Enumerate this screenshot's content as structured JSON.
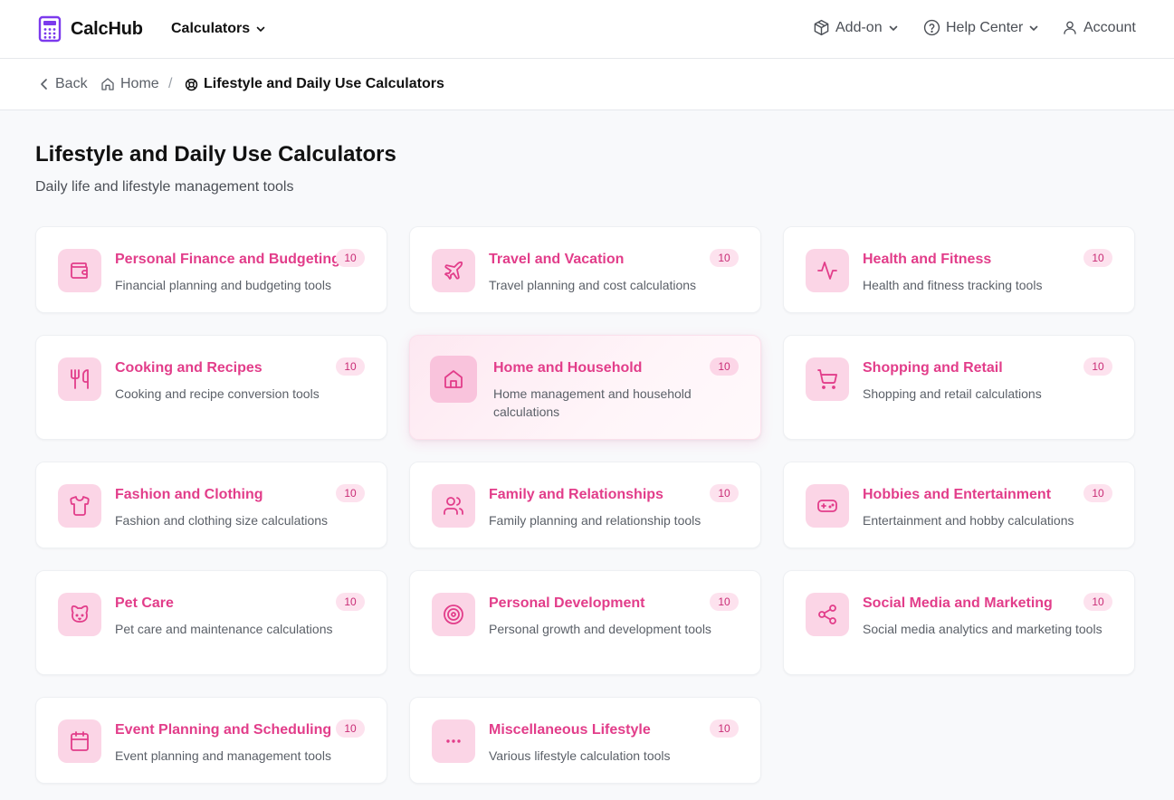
{
  "app": {
    "name": "CalcHub"
  },
  "nav": {
    "calculators_label": "Calculators",
    "addon_label": "Add-on",
    "help_label": "Help Center",
    "account_label": "Account"
  },
  "breadcrumb": {
    "back_label": "Back",
    "home_label": "Home",
    "separator": "/",
    "current_label": "Lifestyle and Daily Use Calculators"
  },
  "page": {
    "title": "Lifestyle and Daily Use Calculators",
    "subtitle": "Daily life and lifestyle management tools"
  },
  "colors": {
    "accent": "#e23d8a",
    "icon_bg": "#fbd5e6",
    "badge_bg": "#fde2ee",
    "brand": "#7c3aed"
  },
  "categories": [
    {
      "title": "Personal Finance and Budgeting",
      "desc": "Financial planning and budgeting tools",
      "count": "10",
      "icon": "wallet-icon"
    },
    {
      "title": "Travel and Vacation",
      "desc": "Travel planning and cost calculations",
      "count": "10",
      "icon": "plane-icon"
    },
    {
      "title": "Health and Fitness",
      "desc": "Health and fitness tracking tools",
      "count": "10",
      "icon": "activity-icon"
    },
    {
      "title": "Cooking and Recipes",
      "desc": "Cooking and recipe conversion tools",
      "count": "10",
      "icon": "utensils-icon"
    },
    {
      "title": "Home and Household",
      "desc": "Home management and household calculations",
      "count": "10",
      "icon": "home-icon",
      "active": true
    },
    {
      "title": "Shopping and Retail",
      "desc": "Shopping and retail calculations",
      "count": "10",
      "icon": "cart-icon"
    },
    {
      "title": "Fashion and Clothing",
      "desc": "Fashion and clothing size calculations",
      "count": "10",
      "icon": "shirt-icon"
    },
    {
      "title": "Family and Relationships",
      "desc": "Family planning and relationship tools",
      "count": "10",
      "icon": "users-icon"
    },
    {
      "title": "Hobbies and Entertainment",
      "desc": "Entertainment and hobby calculations",
      "count": "10",
      "icon": "gamepad-icon"
    },
    {
      "title": "Pet Care",
      "desc": "Pet care and maintenance calculations",
      "count": "10",
      "icon": "pet-icon"
    },
    {
      "title": "Personal Development",
      "desc": "Personal growth and development tools",
      "count": "10",
      "icon": "target-icon"
    },
    {
      "title": "Social Media and Marketing",
      "desc": "Social media analytics and marketing tools",
      "count": "10",
      "icon": "share-icon"
    },
    {
      "title": "Event Planning and Scheduling",
      "desc": "Event planning and management tools",
      "count": "10",
      "icon": "calendar-icon"
    },
    {
      "title": "Miscellaneous Lifestyle",
      "desc": "Various lifestyle calculation tools",
      "count": "10",
      "icon": "more-icon"
    }
  ]
}
